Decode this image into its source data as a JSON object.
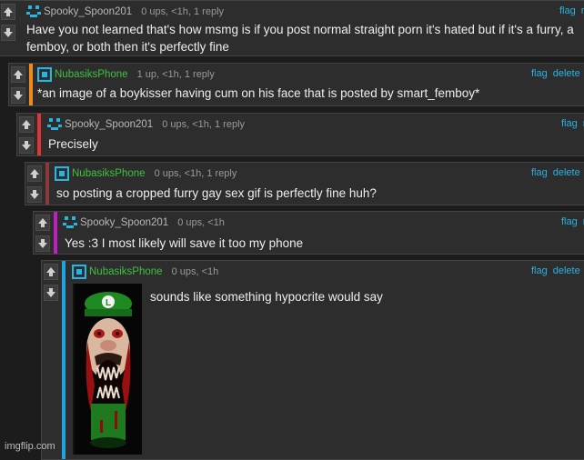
{
  "colors": {
    "link": "#2ab4e2",
    "bar_orange": "#f08a1c",
    "bar_red": "#e03535",
    "bar_maroon": "#8b3a3a",
    "bar_magenta": "#c01fc0",
    "bar_blue": "#1fa3e0",
    "spooky_name": "#b8b8b8",
    "nubasik_name": "#3ec13e"
  },
  "comments": [
    {
      "user": "Spooky_Spoon201",
      "meta": "0 ups, <1h, 1 reply",
      "actions": [
        "flag",
        "r"
      ],
      "text": "Have you not learned that's how msmg is if you post normal straight porn it's hated but if it's a furry, a femboy, or both then it's perfectly fine",
      "avatar_icon": "spooky-face-icon"
    },
    {
      "user": "NubasiksPhone",
      "meta": "1 up, <1h, 1 reply",
      "actions": [
        "flag",
        "delete",
        "r"
      ],
      "text": "*an image of a boykisser having cum on his face that is posted by smart_femboy*",
      "avatar_icon": "blue-square-icon"
    },
    {
      "user": "Spooky_Spoon201",
      "meta": "0 ups, <1h, 1 reply",
      "actions": [
        "flag",
        "r"
      ],
      "text": "Precisely",
      "avatar_icon": "spooky-face-icon"
    },
    {
      "user": "NubasiksPhone",
      "meta": "0 ups, <1h, 1 reply",
      "actions": [
        "flag",
        "delete",
        "r"
      ],
      "text": "so posting a cropped furry gay sex gif is perfectly fine huh?",
      "avatar_icon": "blue-square-icon"
    },
    {
      "user": "Spooky_Spoon201",
      "meta": "0 ups, <1h",
      "actions": [
        "flag",
        "r"
      ],
      "text": "Yes :3 I most likely will save it too my phone",
      "avatar_icon": "spooky-face-icon"
    },
    {
      "user": "NubasiksPhone",
      "meta": "0 ups, <1h",
      "actions": [
        "flag",
        "delete",
        "r"
      ],
      "text": "sounds like something hypocrite would say",
      "avatar_icon": "blue-square-icon"
    }
  ],
  "watermark": "imgflip.com"
}
